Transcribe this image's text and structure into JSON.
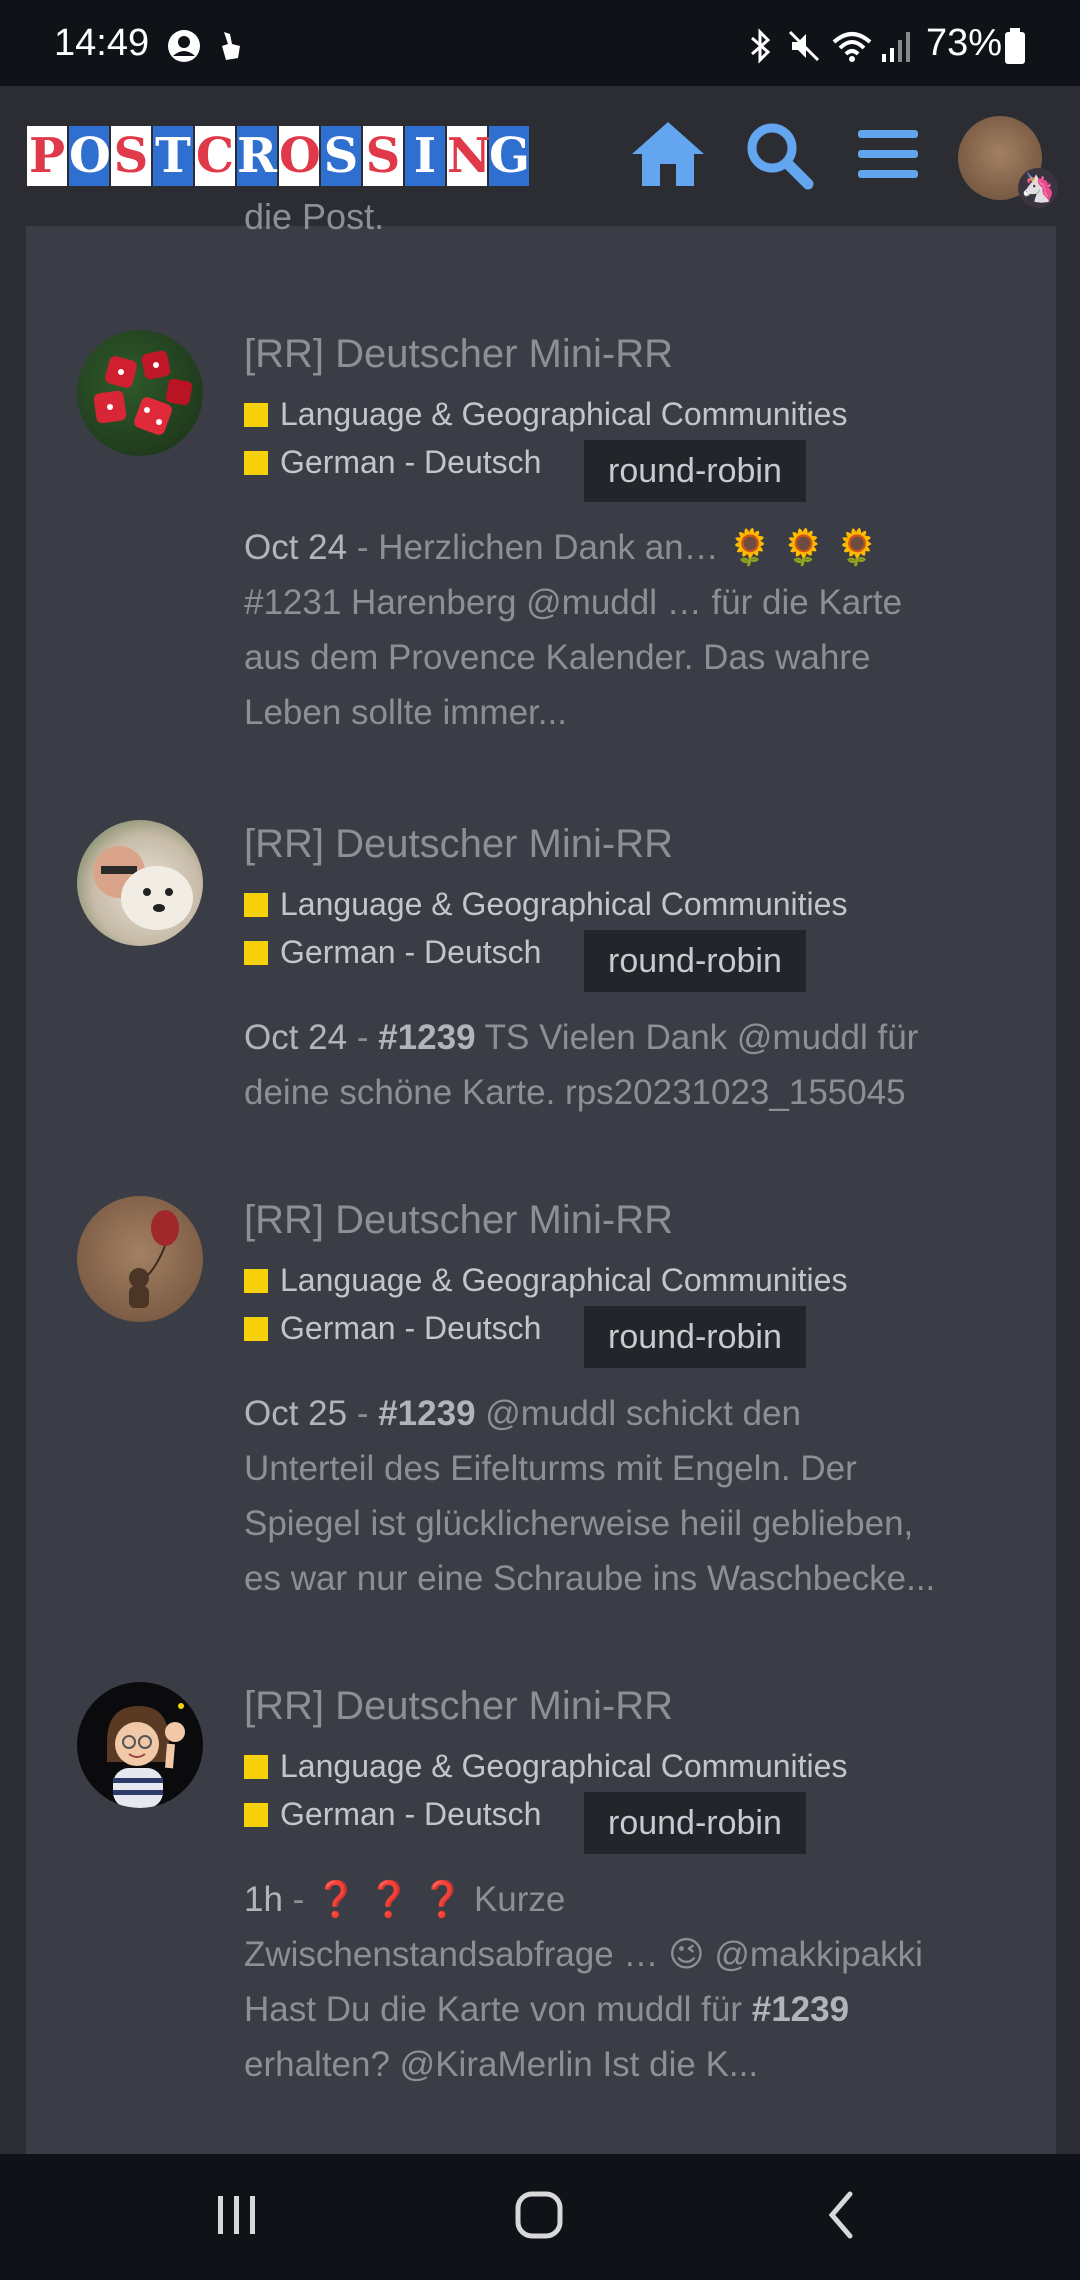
{
  "status": {
    "time": "14:49",
    "battery": "73%"
  },
  "header": {
    "logo_letters": [
      "P",
      "O",
      "S",
      "T",
      "C",
      "R",
      "O",
      "S",
      "S",
      "I",
      "N",
      "G"
    ],
    "icons": [
      "home-icon",
      "search-icon",
      "menu-icon",
      "avatar"
    ]
  },
  "cutoff_text": "die Post.",
  "items": [
    {
      "title": "[RR] Deutscher Mini-RR",
      "category": "Language & Geographical Communities",
      "subcategory": "German - Deutsch",
      "tag": "round-robin",
      "date": "Oct 24",
      "excerpt_a": " - Herzlichen Dank an… 🌻 🌻 🌻",
      "excerpt_b": "#1231 Harenberg @muddl … für die Karte",
      "excerpt_c": "aus dem Provence Kalender. Das wahre",
      "excerpt_d": "Leben sollte immer..."
    },
    {
      "title": "[RR] Deutscher Mini-RR",
      "category": "Language & Geographical Communities",
      "subcategory": "German - Deutsch",
      "tag": "round-robin",
      "date": "Oct 24",
      "sep": " - ",
      "bold": "#1239",
      "excerpt_a": " TS Vielen Dank @muddl für",
      "excerpt_b": "deine schöne Karte. rps20231023_155045"
    },
    {
      "title": "[RR] Deutscher Mini-RR",
      "category": "Language & Geographical Communities",
      "subcategory": "German - Deutsch",
      "tag": "round-robin",
      "date": "Oct 25",
      "sep": " - ",
      "bold": "#1239",
      "excerpt_a": " @muddl schickt den",
      "excerpt_b": "Unterteil des Eifelturms mit Engeln. Der",
      "excerpt_c": "Spiegel ist glücklicherweise heiil geblieben,",
      "excerpt_d": "es war nur eine Schraube ins Waschbecke..."
    },
    {
      "title": "[RR] Deutscher Mini-RR",
      "category": "Language & Geographical Communities",
      "subcategory": "German - Deutsch",
      "tag": "round-robin",
      "date": "1h",
      "excerpt_a": " - ❓ ❓ ❓ Kurze",
      "excerpt_b": "Zwischenstandsabfrage … 😉 @makkipakki",
      "excerpt_c": "Hast Du die Karte von muddl für ",
      "bold": "#1239",
      "excerpt_d": "erhalten? @KiraMerlin Ist die K..."
    }
  ],
  "navbar": {
    "icons": [
      "recent-apps-icon",
      "home-nav-icon",
      "back-icon"
    ]
  }
}
